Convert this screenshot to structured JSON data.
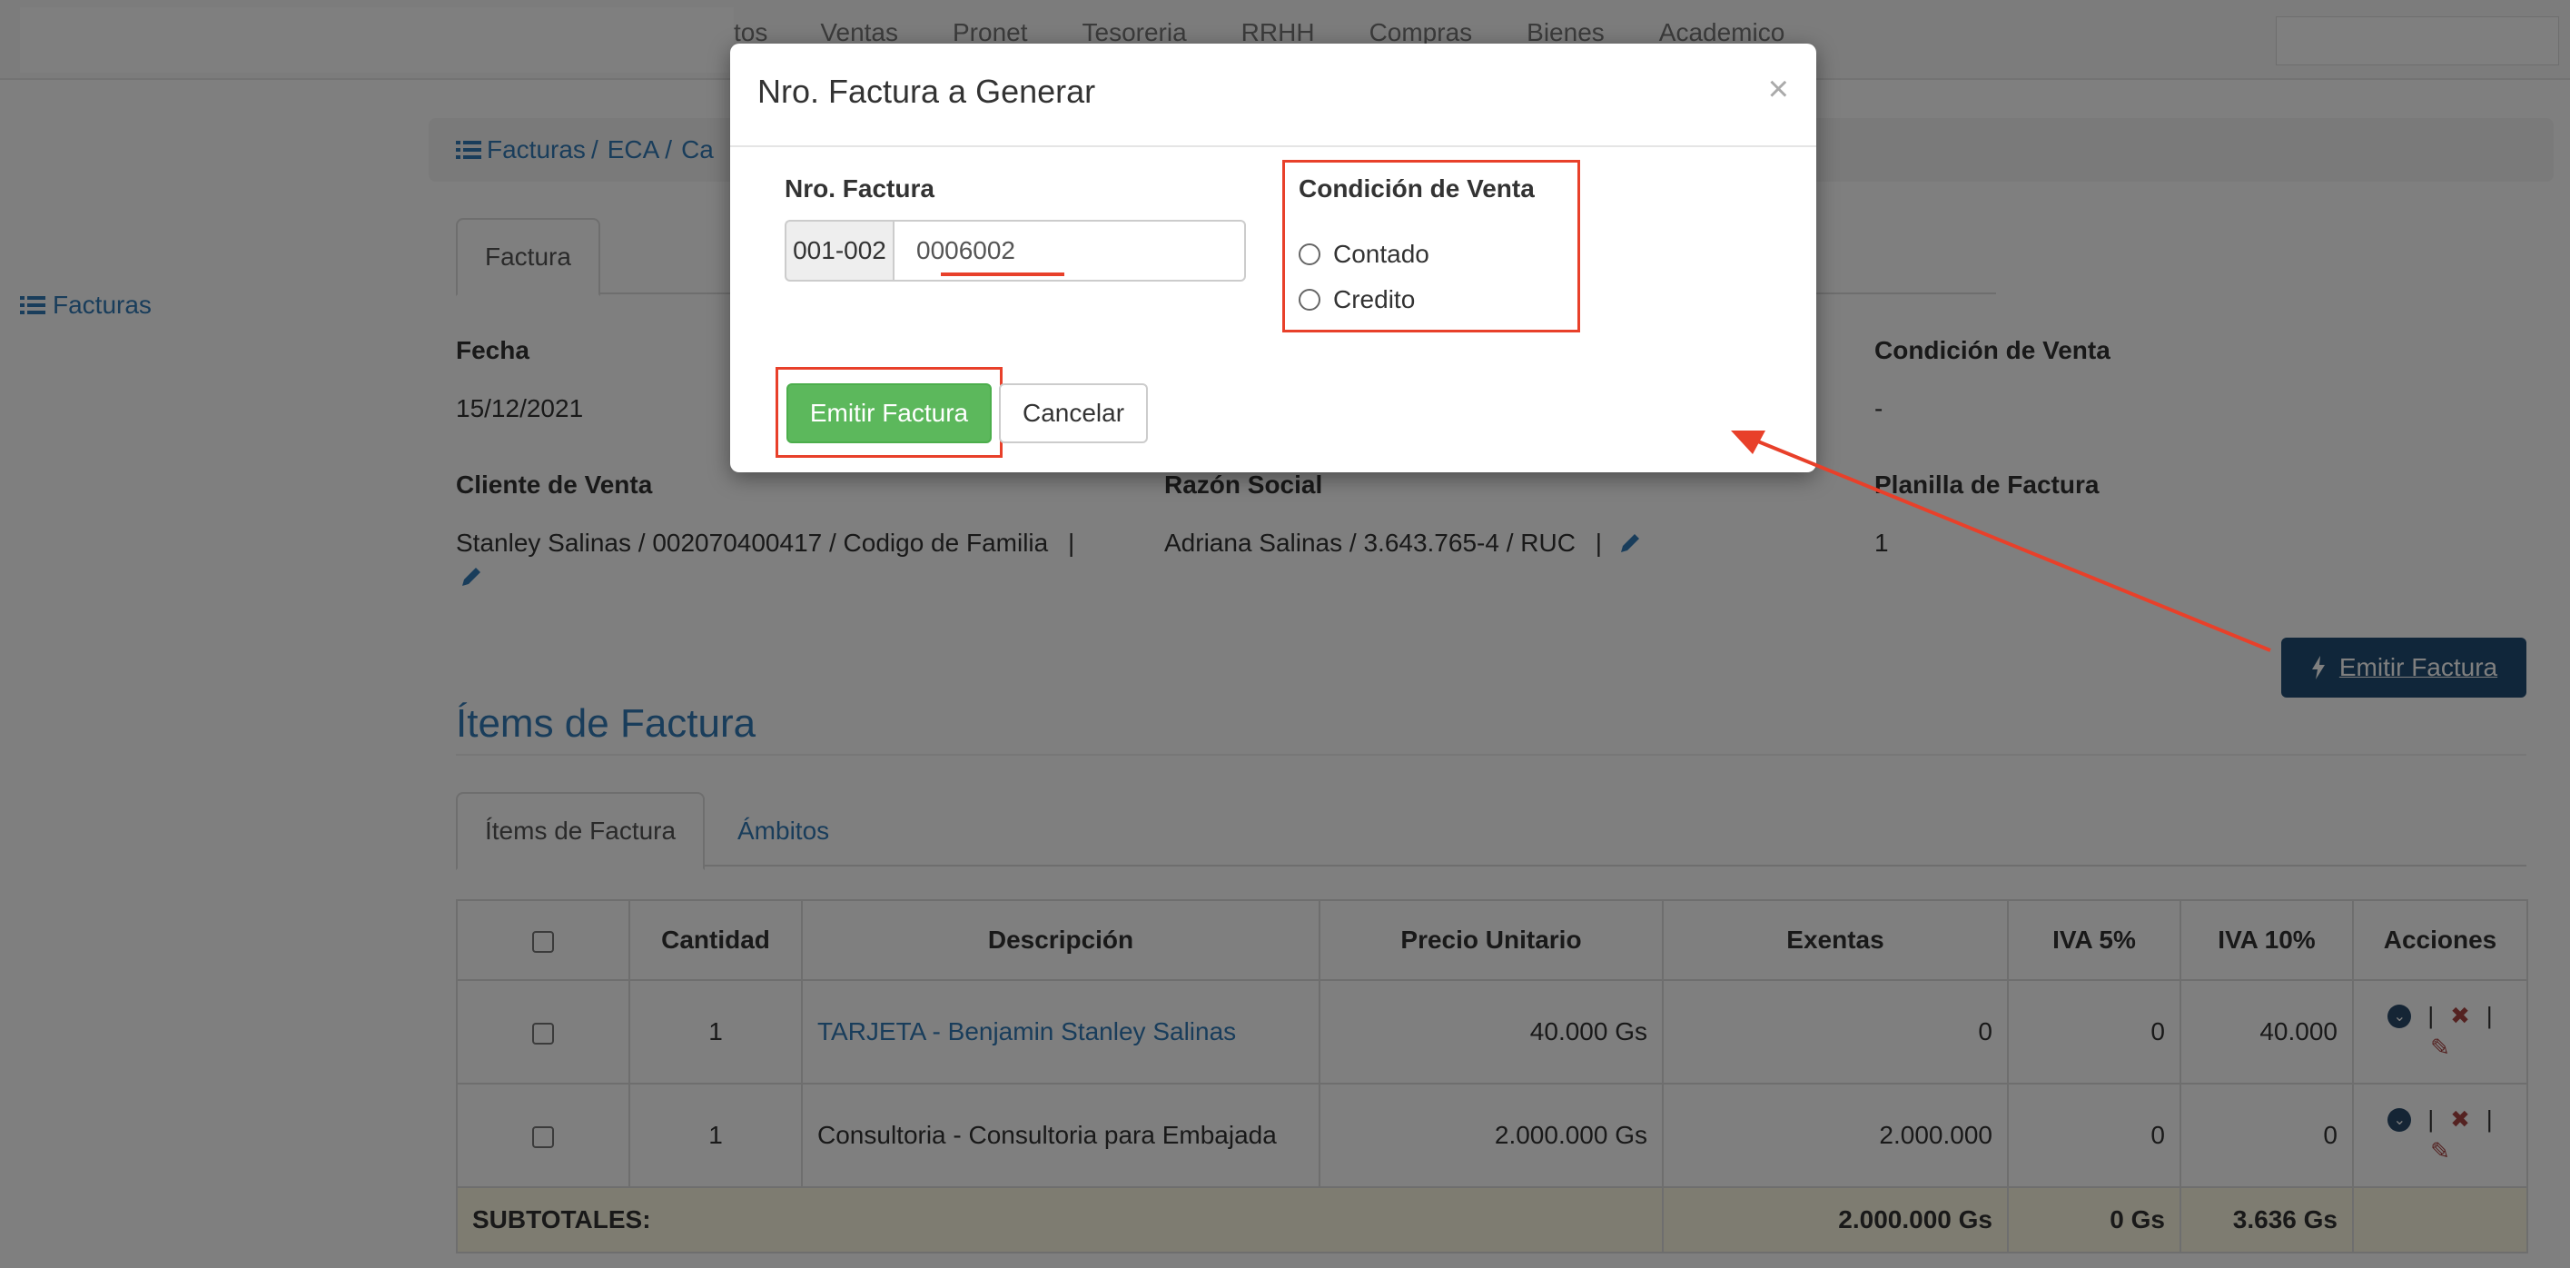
{
  "navbar": {
    "items": [
      "tos",
      "Ventas",
      "Pronet",
      "Tesoreria",
      "RRHH",
      "Compras",
      "Bienes",
      "Academico"
    ]
  },
  "sidebar": {
    "facturas_label": "Facturas"
  },
  "breadcrumb": {
    "items": [
      "Facturas",
      "ECA",
      "Ca"
    ]
  },
  "tabs_top": {
    "active": "Factura"
  },
  "details": {
    "fecha_label": "Fecha",
    "fecha_value": "15/12/2021",
    "condicion_label": "Condición de Venta",
    "condicion_value": "-",
    "cliente_label": "Cliente de Venta",
    "cliente_value": "Stanley Salinas / 002070400417 / Codigo de Familia",
    "razon_label": "Razón Social",
    "razon_value": "Adriana Salinas / 3.643.765-4 / RUC",
    "planilla_label": "Planilla de Factura",
    "planilla_value": "1",
    "separator": "|"
  },
  "emitir_button": {
    "label": "Emitir Factura"
  },
  "items_section": {
    "heading": "Ítems de Factura",
    "tabs": [
      "Ítems de Factura",
      "Ámbitos"
    ]
  },
  "table": {
    "headers": [
      "",
      "Cantidad",
      "Descripción",
      "Precio Unitario",
      "Exentas",
      "IVA 5%",
      "IVA 10%",
      "Acciones"
    ],
    "rows": [
      {
        "cantidad": "1",
        "descripcion": "TARJETA - Benjamin Stanley Salinas",
        "precio": "40.000 Gs",
        "exentas": "0",
        "iva5": "0",
        "iva10": "40.000"
      },
      {
        "cantidad": "1",
        "descripcion": "Consultoria - Consultoria para Embajada",
        "precio": "2.000.000 Gs",
        "exentas": "2.000.000",
        "iva5": "0",
        "iva10": "0"
      }
    ],
    "subtotals": {
      "label": "SUBTOTALES:",
      "exentas": "2.000.000 Gs",
      "iva5": "0 Gs",
      "iva10": "3.636 Gs"
    }
  },
  "modal": {
    "title": "Nro. Factura a Generar",
    "close": "×",
    "nro_label": "Nro. Factura",
    "prefix": "001-002",
    "nro_value": "0006002",
    "condicion_label": "Condición de Venta",
    "options": [
      "Contado",
      "Credito"
    ],
    "emit_label": "Emitir Factura",
    "cancel_label": "Cancelar"
  },
  "colors": {
    "primary": "#337ab7",
    "success": "#5cb85c",
    "annotation": "#e8402a",
    "emit_dark": "#204d74"
  },
  "icons": [
    "list-icon",
    "pencil-icon",
    "bolt-icon",
    "chevron-circle-icon",
    "close-x-icon"
  ]
}
